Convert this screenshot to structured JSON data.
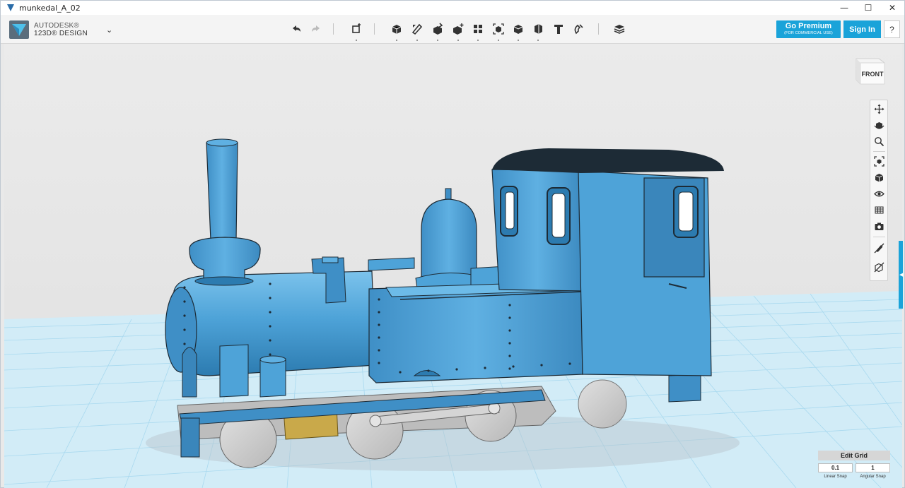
{
  "window": {
    "title": "munkedal_A_02",
    "min": "—",
    "max": "☐",
    "close": "✕"
  },
  "brand": {
    "line1": "AUTODESK®",
    "line2": "123D® DESIGN"
  },
  "toolbar": {
    "tools": [
      "undo-icon",
      "redo-icon",
      "transform-icon",
      "primitives-icon",
      "sketch-icon",
      "construct-icon",
      "modify-icon",
      "pattern-icon",
      "grouping-icon",
      "combine-icon",
      "measure-icon",
      "text-icon",
      "snap-icon",
      "material-icon"
    ]
  },
  "header": {
    "premium_label": "Go Premium",
    "premium_sub": "(FOR COMMERCIAL USE)",
    "signin_label": "Sign In",
    "help_label": "?"
  },
  "viewcube": {
    "face_label": "FRONT"
  },
  "navbar": {
    "items": [
      "pan-icon",
      "orbit-icon",
      "zoom-icon",
      "fit-icon",
      "view-icon",
      "visibility-icon",
      "grid-icon",
      "screenshot-icon",
      "hide-sketches-icon",
      "hide-meshes-icon"
    ]
  },
  "edit_grid": {
    "title": "Edit Grid",
    "linear_value": "0.1",
    "linear_label": "Linear Snap",
    "angular_value": "1",
    "angular_label": "Angular Snap"
  },
  "colors": {
    "accent": "#1aa3d9",
    "model": "#4aa0d5",
    "model_dark": "#1d2b36",
    "brass": "#c9a94a",
    "wheel": "#c9c9c9",
    "grid": "#9fd3ec"
  }
}
